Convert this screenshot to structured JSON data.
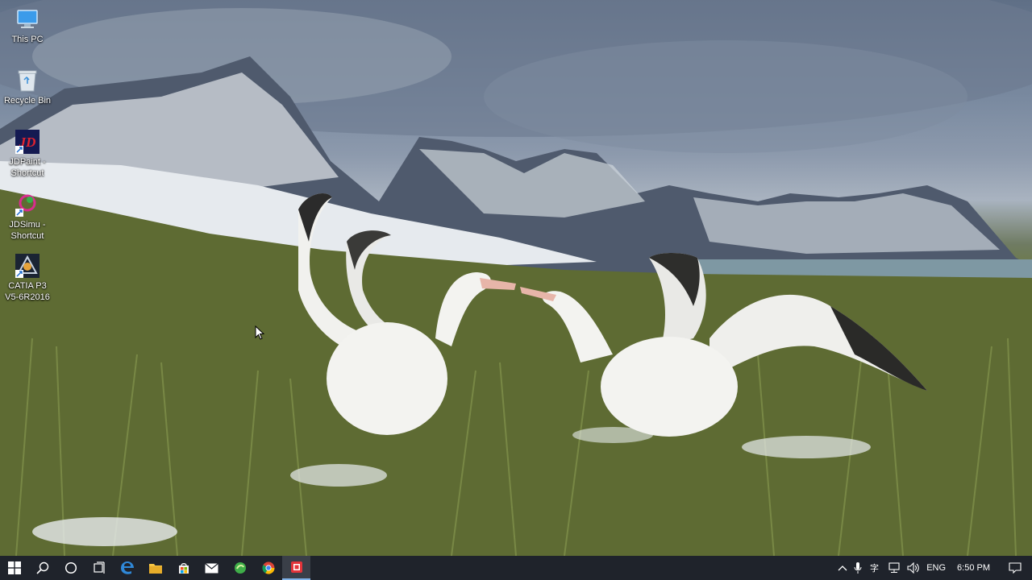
{
  "desktop": {
    "icons": [
      {
        "label": "This PC",
        "icon": "this-pc-icon"
      },
      {
        "label": "Recycle Bin",
        "icon": "recycle-bin-icon"
      },
      {
        "label": "JDPaint -\nShortcut",
        "icon": "jdpaint-icon"
      },
      {
        "label": "JDSimu -\nShortcut",
        "icon": "jdsimu-icon"
      },
      {
        "label": "CATIA P3\nV5-6R2016",
        "icon": "catia-icon"
      }
    ]
  },
  "taskbar": {
    "pinned": [
      {
        "name": "start",
        "icon": "windows-logo-icon"
      },
      {
        "name": "search",
        "icon": "search-icon"
      },
      {
        "name": "cortana",
        "icon": "cortana-circle-icon"
      },
      {
        "name": "task-view",
        "icon": "task-view-icon"
      },
      {
        "name": "edge",
        "icon": "edge-icon"
      },
      {
        "name": "file-explorer",
        "icon": "folder-icon"
      },
      {
        "name": "store",
        "icon": "store-icon"
      },
      {
        "name": "mail",
        "icon": "mail-icon"
      },
      {
        "name": "green-app",
        "icon": "green-app-icon"
      },
      {
        "name": "chrome",
        "icon": "chrome-icon"
      },
      {
        "name": "red-app",
        "icon": "red-app-icon"
      }
    ],
    "tray": {
      "language": "ENG",
      "time": "6:50 PM"
    }
  },
  "colors": {
    "taskbar_bg": "#1f232b",
    "accent": "#7fb2e8"
  }
}
